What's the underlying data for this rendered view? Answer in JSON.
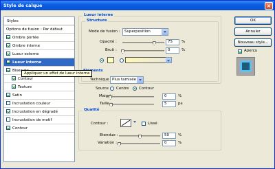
{
  "window": {
    "title": "Style de calque",
    "close_glyph": "×"
  },
  "styles_panel": {
    "header": "Styles",
    "items": [
      {
        "label": "Options de fusion : Par défaut",
        "checkbox": false,
        "checked": false,
        "sub": false,
        "selected": false
      },
      {
        "label": "Ombre portée",
        "checkbox": true,
        "checked": true,
        "sub": false,
        "selected": false
      },
      {
        "label": "Ombre interne",
        "checkbox": true,
        "checked": true,
        "sub": false,
        "selected": false
      },
      {
        "label": "Lueur externe",
        "checkbox": true,
        "checked": true,
        "sub": false,
        "selected": false
      },
      {
        "label": "Lueur interne",
        "checkbox": true,
        "checked": true,
        "sub": false,
        "selected": true
      },
      {
        "label": "Biseauta",
        "checkbox": true,
        "checked": true,
        "sub": false,
        "selected": false
      },
      {
        "label": "Contour",
        "checkbox": true,
        "checked": true,
        "sub": true,
        "selected": false
      },
      {
        "label": "Texture",
        "checkbox": true,
        "checked": true,
        "sub": true,
        "selected": false
      },
      {
        "label": "Satin",
        "checkbox": true,
        "checked": true,
        "sub": false,
        "selected": false
      },
      {
        "label": "Incrustation couleur",
        "checkbox": true,
        "checked": false,
        "sub": false,
        "selected": false
      },
      {
        "label": "Incrustation en dégradé",
        "checkbox": true,
        "checked": true,
        "sub": false,
        "selected": false
      },
      {
        "label": "Incrustation de motif",
        "checkbox": true,
        "checked": false,
        "sub": false,
        "selected": false
      },
      {
        "label": "Contour",
        "checkbox": true,
        "checked": true,
        "sub": false,
        "selected": false
      }
    ]
  },
  "tooltip": "Appliquer un effet de lueur interne",
  "main": {
    "title": "Lueur interne",
    "structure": {
      "title": "Structure",
      "blend_mode_label": "Mode de fusion :",
      "blend_mode_value": "Superposition",
      "opacity_label": "Opacité :",
      "opacity_value": "75",
      "opacity_level": 0.75,
      "noise_label": "Bruit :",
      "noise_value": "0",
      "noise_level": 0,
      "unit_percent": "%",
      "color_swatch": "#ffffbe"
    },
    "elements": {
      "title": "Eléments",
      "technique_label": "Technique :",
      "technique_value": "Plus tamisée",
      "source_label": "Source :",
      "source_center": "Centre",
      "source_contour": "Contour",
      "choke_label": "Maigri :",
      "choke_value": "0",
      "choke_level": 0,
      "size_label": "Taille :",
      "size_value": "5",
      "size_level": 0.02,
      "unit_percent": "%",
      "unit_px": "px"
    },
    "quality": {
      "title": "Qualité",
      "contour_label": "Contour :",
      "smooth_label": "Lissé",
      "range_label": "Etendue :",
      "range_value": "50",
      "range_level": 0.5,
      "jitter_label": "Variation :",
      "jitter_value": "0",
      "jitter_level": 0,
      "unit_percent": "%"
    }
  },
  "buttons": {
    "ok": "OK",
    "cancel": "Annuler",
    "new_style": "Nouveau style...",
    "preview_label": "Aperçu",
    "preview_checked": true
  }
}
